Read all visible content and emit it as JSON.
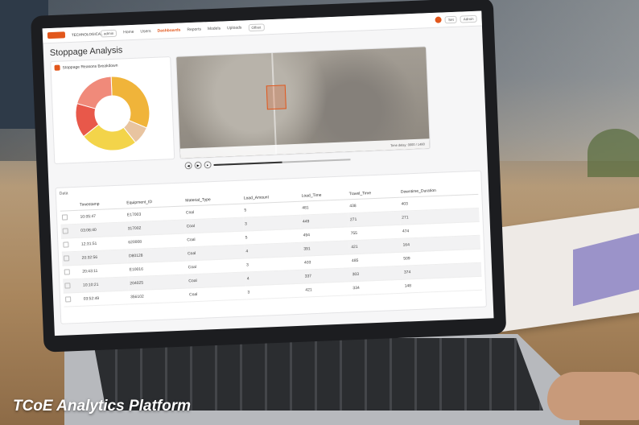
{
  "caption": "TCoE Analytics Platform",
  "app": {
    "nav": {
      "brand": "TECHNOLOGICAL",
      "env": "admin",
      "tabs": [
        "Home",
        "Users",
        "Dashboards",
        "Reports",
        "Models",
        "Uploads"
      ],
      "selected_tab": "Dashboards",
      "search_value": "Offset",
      "settings_label": "Set",
      "admin_label": "Admin"
    },
    "page_title": "Stoppage Analysis",
    "pie_card": {
      "title": "Stoppage Reasons Breakdown",
      "slices": [
        {
          "value": 32,
          "color": "#f0b43a"
        },
        {
          "value": 8,
          "color": "#e8c4a0"
        },
        {
          "value": 25,
          "color": "#f3d44a"
        },
        {
          "value": 15,
          "color": "#e8584a"
        },
        {
          "value": 20,
          "color": "#f08a7a"
        }
      ]
    },
    "map_card": {
      "timestamp_label": "Time delay: 0000 / 1480",
      "progress": 0.5
    },
    "data_card": {
      "label": "Data",
      "columns": [
        "Timestamp",
        "Equipment_ID",
        "Material_Type",
        "Load_Amount",
        "Load_Time",
        "Travel_Time",
        "Downtime_Duration"
      ],
      "rows": [
        [
          "10:05:47",
          "E17003",
          "Coal",
          "5",
          "481",
          "438",
          "403"
        ],
        [
          "03:08:40",
          "317002",
          "Coal",
          "3",
          "449",
          "271",
          "271"
        ],
        [
          "12:31:51",
          "620008",
          "Coal",
          "5",
          "494",
          "755",
          "474"
        ],
        [
          "20:32:56",
          "D80128",
          "Coal",
          "4",
          "391",
          "421",
          "164"
        ],
        [
          "20:43:11",
          "E10016",
          "Coal",
          "3",
          "403",
          "485",
          "509"
        ],
        [
          "10:10:21",
          "204025",
          "Coal",
          "4",
          "337",
          "303",
          "374"
        ],
        [
          "03:52:49",
          "356102",
          "Coal",
          "3",
          "421",
          "334",
          "148"
        ]
      ]
    }
  }
}
